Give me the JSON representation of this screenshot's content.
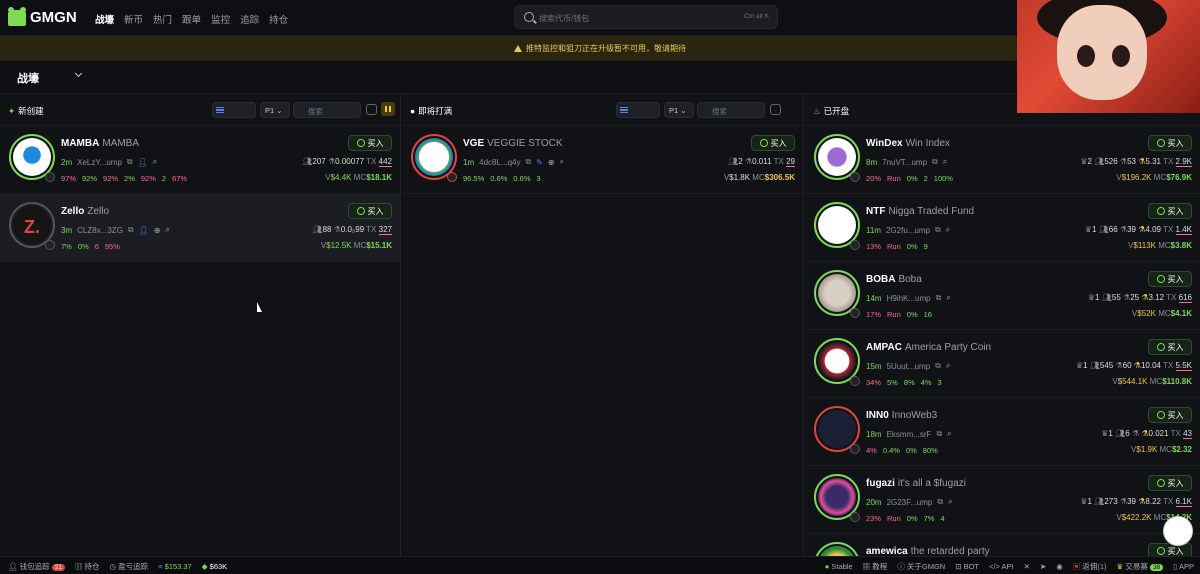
{
  "app": {
    "name": "GMGN",
    "nav": [
      "战壕",
      "新币",
      "热门",
      "跟单",
      "监控",
      "追踪",
      "持仓"
    ],
    "search_placeholder": "搜索代币/钱包",
    "search_shortcut": "Ctrl alt K"
  },
  "banner": "推特监控和狙刀正在升级暂不可用，敬请期待",
  "page_title": "战壕",
  "columns": [
    {
      "title": "新创建",
      "page": "P1",
      "search": "搜索"
    },
    {
      "title": "即将打满",
      "page": "P1",
      "search": "搜索"
    },
    {
      "title": "已开盘"
    }
  ],
  "buy_label": "买入",
  "new_tokens": [
    {
      "ticker": "MAMBA",
      "name": "MAMBA",
      "age": "2m",
      "addr": "XeLzY...ump",
      "holders": "207",
      "price": "0.00077",
      "tx_label": "TX",
      "tx": "442",
      "p1": "97%",
      "p2": "92%",
      "p3": "92%",
      "p4": "2%",
      "p5": "92%",
      "p6": "2",
      "p7": "67%",
      "v": "$4.4K",
      "mc": "$18.1K"
    },
    {
      "ticker": "Zello",
      "name": "Zello",
      "age": "3m",
      "addr": "CLZ8x...3ZG",
      "holders": "88",
      "price": "0.0₃99",
      "tx_label": "TX",
      "tx": "327",
      "p1": "7%",
      "p2": "0%",
      "p3": "6",
      "p4": "95%",
      "v": "$12.5K",
      "mc": "$15.1K"
    }
  ],
  "soon_tokens": [
    {
      "ticker": "VGE",
      "name": "VEGGIE STOCK",
      "age": "1m",
      "addr": "4dc8L...q4y",
      "holders": "2",
      "price": "0.011",
      "tx_label": "TX",
      "tx": "29",
      "p1": "96.5%",
      "p2": "0.6%",
      "p3": "0.6%",
      "p4": "3",
      "v": "$1.8K",
      "mc": "$306.5K"
    }
  ],
  "open_tokens": [
    {
      "ticker": "WinDex",
      "name": "Win Index",
      "age": "8m",
      "addr": "7nuVT...ump",
      "s1": "2",
      "holders": "526",
      "s3": "53",
      "price": "5.31",
      "tx_label": "TX",
      "tx": "2.9K",
      "p1": "20%",
      "p2": "Run",
      "p3": "0%",
      "p4": "2",
      "p5": "100%",
      "v": "$196.2K",
      "mc": "$76.9K"
    },
    {
      "ticker": "NTF",
      "name": "Nigga Traded Fund",
      "age": "11m",
      "addr": "2G2fu...ump",
      "s1": "1",
      "holders": "66",
      "s3": "39",
      "price": "4.09",
      "tx_label": "TX",
      "tx": "1.4K",
      "p1": "13%",
      "p2": "Run",
      "p3": "0%",
      "p4": "9",
      "v": "$113K",
      "mc": "$3.8K"
    },
    {
      "ticker": "BOBA",
      "name": "Boba",
      "age": "14m",
      "addr": "H9ihK...ump",
      "s1": "1",
      "holders": "55",
      "s3": "25",
      "price": "3.12",
      "tx_label": "TX",
      "tx": "616",
      "p1": "17%",
      "p2": "Run",
      "p3": "0%",
      "p4": "16",
      "v": "$52K",
      "mc": "$4.1K"
    },
    {
      "ticker": "AMPAC",
      "name": "America Party Coin",
      "age": "15m",
      "addr": "5Uuut...ump",
      "s1": "1",
      "holders": "545",
      "s3": "60",
      "price": "10.04",
      "tx_label": "TX",
      "tx": "5.5K",
      "p1": "34%",
      "p2": "5%",
      "p3": "8%",
      "p4": "4%",
      "p5": "3",
      "v": "$544.1K",
      "mc": "$110.8K"
    },
    {
      "ticker": "INN0",
      "name": "InnoWeb3",
      "age": "18m",
      "addr": "Eksmm...srF",
      "s1": "1",
      "holders": "6",
      "s3": "",
      "price": "0.021",
      "tx_label": "TX",
      "tx": "43",
      "p1": "4%",
      "p2": "0.4%",
      "p3": "0%",
      "p4": "80%",
      "v": "$1.9K",
      "mc": "$2.32"
    },
    {
      "ticker": "fugazi",
      "name": "it's all a $fugazi",
      "age": "20m",
      "addr": "2G23F...ump",
      "s1": "1",
      "holders": "273",
      "s3": "39",
      "price": "8.22",
      "tx_label": "TX",
      "tx": "6.1K",
      "p1": "23%",
      "p2": "Run",
      "p3": "0%",
      "p4": "7%",
      "p5": "4",
      "v": "$422.2K",
      "mc": "$14.2K"
    },
    {
      "ticker": "amewica",
      "name": "the retarded party"
    }
  ],
  "footer": {
    "left": [
      "钱包追踪",
      "持仓",
      "盈亏追踪"
    ],
    "wallet_count": "21",
    "sol_price": "$153.37",
    "other_price": "$63K",
    "right": [
      "Stable",
      "教程",
      "关于GMGN",
      "BOT",
      "API",
      "",
      "",
      "",
      "",
      "返佣(1)",
      "交易赛",
      "APP"
    ],
    "contest_badge": "38"
  }
}
